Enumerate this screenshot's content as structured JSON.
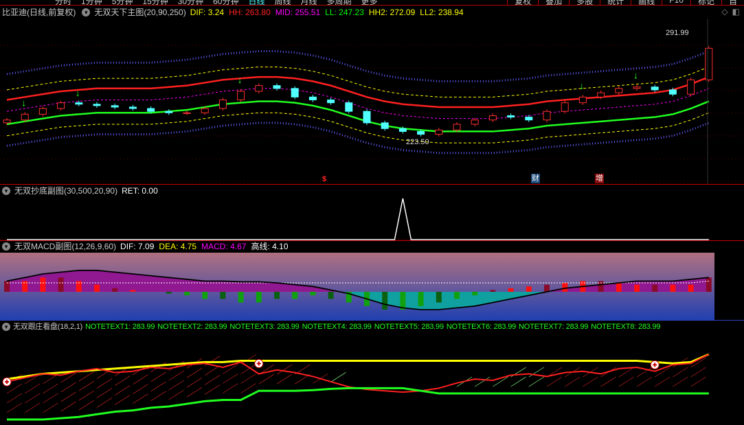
{
  "topbar": {
    "tabs": [
      "分时",
      "1分钟",
      "5分钟",
      "15分钟",
      "30分钟",
      "60分钟",
      "日线",
      "周线",
      "月线",
      "多周期",
      "更多"
    ],
    "active": "日线",
    "buttons": [
      "复权",
      "叠加",
      "多股",
      "统计",
      "画线",
      "F10",
      "标记",
      "自"
    ]
  },
  "main": {
    "stock": "比亚迪(日线,前复权)",
    "indicator": "无双天下主图(20,90,250)",
    "values": [
      {
        "label": "DIF: 3.24",
        "color": "#ffff00"
      },
      {
        "label": "HH: 263.80",
        "color": "#ff2020"
      },
      {
        "label": "MID: 255.51",
        "color": "#ff00ff"
      },
      {
        "label": "LL: 247.23",
        "color": "#00ff00"
      },
      {
        "label": "HH2: 272.09",
        "color": "#ffff00"
      },
      {
        "label": "LL2: 238.94",
        "color": "#ffff00"
      }
    ],
    "high_label": "291.99",
    "low_label": "223.50",
    "event_tags": [
      "$",
      "财",
      "增"
    ]
  },
  "sub1": {
    "title": "无双抄底副图(30,500,20,90)",
    "value": "RET: 0.00"
  },
  "macd": {
    "title": "无双MACD副图(12,26,9,60)",
    "values": [
      {
        "label": "DIF: 7.09",
        "color": "#ffffff"
      },
      {
        "label": "DEA: 4.75",
        "color": "#ffff00"
      },
      {
        "label": "MACD: 4.67",
        "color": "#ff00ff"
      },
      {
        "label": "高线: 4.10",
        "color": "#ffffff"
      }
    ]
  },
  "bottom": {
    "title": "无双跟庄看盘(18,2,1)",
    "values": [
      "NOTETEXT1: 283.99",
      "NOTETEXT2: 283.99",
      "NOTETEXT3: 283.99",
      "NOTETEXT4: 283.99",
      "NOTETEXT5: 283.99",
      "NOTETEXT6: 283.99",
      "NOTETEXT7: 283.99",
      "NOTETEXT8: 283.99"
    ]
  },
  "chart_data": [
    {
      "type": "candlestick",
      "title": "比亚迪(日线,前复权)",
      "ylim": [
        216,
        296
      ],
      "close": [
        238,
        242,
        246,
        250,
        249,
        248,
        247,
        246,
        244,
        243,
        243,
        246,
        252,
        258,
        262,
        260,
        254,
        252,
        250,
        244,
        236,
        232,
        230,
        228,
        231,
        235,
        238,
        241,
        240,
        238,
        244,
        250,
        254,
        257,
        260,
        261,
        259,
        256,
        266,
        288
      ],
      "mid": [
        252,
        254,
        256,
        258,
        259,
        260,
        260,
        260,
        260,
        261,
        262,
        264,
        266,
        267,
        268,
        268,
        267,
        265,
        262,
        258,
        254,
        251,
        249,
        248,
        247,
        247,
        247,
        247,
        248,
        249,
        251,
        252,
        253,
        254,
        255,
        256,
        257,
        259,
        263,
        268
      ],
      "band_offsets": {
        "blue_upper": 18,
        "yellow_upper": 7,
        "red_mid": 0,
        "magenta_lower": -8,
        "green_lower": -17,
        "yellow_lower": -25,
        "blue_lower": -32
      },
      "buy_arrows": [
        1,
        4,
        13,
        32,
        35
      ],
      "high": 291.99,
      "low": 223.5
    },
    {
      "type": "line",
      "title": "RET",
      "ret": [
        0,
        0,
        0,
        0,
        0,
        0,
        0,
        0,
        0,
        0,
        0,
        0,
        0,
        0,
        0,
        0,
        0,
        0,
        0,
        0,
        0,
        0,
        1,
        0,
        0,
        0,
        0,
        0,
        0,
        0,
        0,
        0,
        0,
        0,
        0,
        0,
        0,
        0,
        0,
        0
      ],
      "ylim": [
        0,
        1
      ]
    },
    {
      "type": "bar",
      "title": "MACD",
      "ylim": [
        -8,
        8
      ],
      "hist": [
        3,
        3,
        4,
        4,
        3,
        2,
        1,
        0.5,
        0,
        -0.5,
        -1,
        -2,
        -2,
        -3,
        -3,
        -2,
        -2,
        -1,
        -2,
        -3,
        -4,
        -5,
        -5,
        -4,
        -3,
        -2,
        -1,
        0.5,
        1,
        1.5,
        2,
        2.5,
        3,
        3,
        2.5,
        2,
        2,
        2,
        2,
        4
      ],
      "dif": [
        3,
        4,
        5,
        5.5,
        6,
        6,
        5.5,
        5,
        4.5,
        4,
        3.5,
        3,
        3,
        2.8,
        2.8,
        2.5,
        2,
        1.5,
        0.5,
        -0.5,
        -2,
        -3.5,
        -4.5,
        -5,
        -5,
        -4.5,
        -4,
        -3,
        -2,
        -1,
        0,
        1,
        1.5,
        2,
        2.5,
        3,
        3,
        3,
        3.5,
        4
      ],
      "dea": [
        2.5,
        2.5,
        2.5,
        2.5,
        2.5,
        2.5,
        2.5,
        2.5,
        2.5,
        2.5,
        2.5,
        2.5,
        2.5,
        2.5,
        2.5,
        2.5,
        2.5,
        2.5,
        2.5,
        2.5,
        2.5,
        2.5,
        2.5,
        2.5,
        2.5,
        2.5,
        2.5,
        2.5,
        2.5,
        2.5,
        2.5,
        2.5,
        2.5,
        2.5,
        2.5,
        2.5,
        2.5,
        2.5,
        2.5,
        3
      ]
    },
    {
      "type": "line",
      "title": "跟庄看盘",
      "ylim": [
        0,
        100
      ],
      "yellow": [
        62,
        66,
        70,
        72,
        74,
        76,
        78,
        80,
        82,
        84,
        86,
        88,
        88,
        90,
        90,
        90,
        90,
        90,
        90,
        90,
        90,
        90,
        90,
        90,
        90,
        90,
        90,
        90,
        90,
        90,
        90,
        90,
        90,
        90,
        90,
        90,
        88,
        86,
        88,
        100
      ],
      "red": [
        58,
        64,
        70,
        68,
        74,
        78,
        72,
        74,
        80,
        78,
        84,
        86,
        80,
        88,
        70,
        76,
        72,
        66,
        58,
        50,
        46,
        44,
        42,
        44,
        48,
        56,
        62,
        60,
        68,
        70,
        66,
        72,
        74,
        70,
        78,
        80,
        74,
        84,
        86,
        100
      ],
      "green": [
        0,
        0,
        0,
        2,
        4,
        8,
        12,
        14,
        18,
        20,
        24,
        28,
        30,
        30,
        44,
        44,
        44,
        45,
        47,
        48,
        48,
        48,
        48,
        44,
        40,
        40,
        40,
        40,
        40,
        40,
        40,
        40,
        40,
        40,
        40,
        40,
        40,
        40,
        40,
        40
      ],
      "markers": [
        0,
        14,
        36
      ]
    }
  ]
}
